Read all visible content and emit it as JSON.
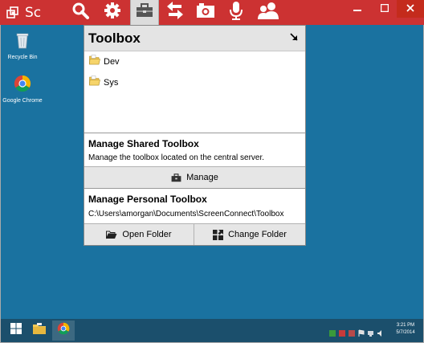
{
  "window": {
    "title": "Sc",
    "toolbar_icons": [
      "search-icon",
      "gear-icon",
      "toolbox-icon",
      "transfer-arrows-icon",
      "camera-icon",
      "microphone-icon",
      "users-icon"
    ],
    "active_tool": "toolbox-icon",
    "controls": [
      "minimize-icon",
      "maximize-icon",
      "close-icon"
    ],
    "colors": {
      "titlebar": "#cc3232",
      "desktop": "#1a72a0",
      "taskbar": "#1b4f6c"
    }
  },
  "desktop": {
    "icons": [
      {
        "label": "Recycle Bin",
        "icon": "recycle-bin-icon"
      },
      {
        "label": "Google Chrome",
        "icon": "chrome-icon"
      }
    ]
  },
  "toolbox": {
    "title": "Toolbox",
    "folders": [
      {
        "name": "Dev",
        "icon": "folder-icon"
      },
      {
        "name": "Sys",
        "icon": "folder-icon"
      }
    ],
    "shared": {
      "title": "Manage Shared Toolbox",
      "description": "Manage the toolbox located on the central server.",
      "manage_label": "Manage"
    },
    "personal": {
      "title": "Manage Personal Toolbox",
      "path": "C:\\Users\\amorgan\\Documents\\ScreenConnect\\Toolbox",
      "open_label": "Open Folder",
      "change_label": "Change Folder"
    }
  },
  "taskbar": {
    "clock_time": "3:21 PM",
    "clock_date": "5/7/2014"
  }
}
